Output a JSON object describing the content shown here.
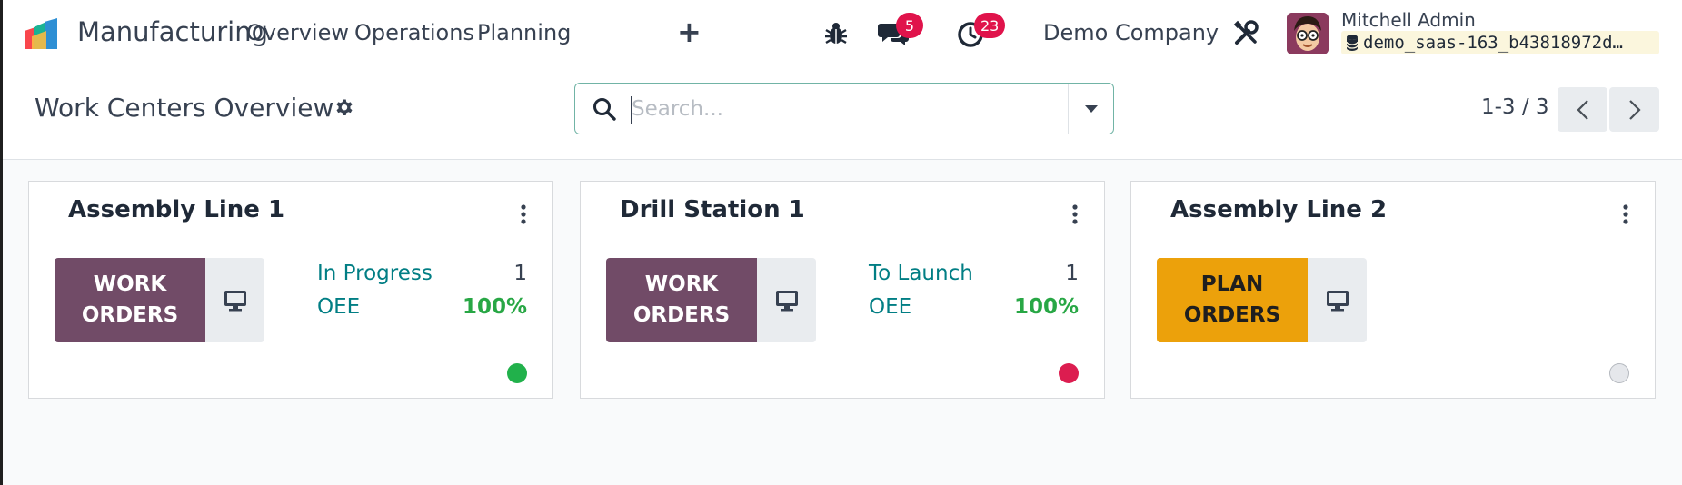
{
  "navbar": {
    "app_name": "Manufacturing",
    "menus": [
      "Overview",
      "Operations",
      "Planning"
    ],
    "add_icon": "plus-icon",
    "messages_badge": "5",
    "activities_badge": "23",
    "company": "Demo Company",
    "user": {
      "name": "Mitchell Admin",
      "database": "demo_saas-163_b43818972d…"
    }
  },
  "control_panel": {
    "title": "Work Centers Overview",
    "search_placeholder": "Search...",
    "pager_value": "1-3 / 3"
  },
  "cards": [
    {
      "title": "Assembly Line 1",
      "button_line1": "WORK",
      "button_line2": "ORDERS",
      "button_color": "#714b67",
      "status_label": "In Progress",
      "status_count": "1",
      "oee_label": "OEE",
      "oee_value": "100%",
      "dot_color": "#21b14b"
    },
    {
      "title": "Drill Station 1",
      "button_line1": "WORK",
      "button_line2": "ORDERS",
      "button_color": "#714b67",
      "status_label": "To Launch",
      "status_count": "1",
      "oee_label": "OEE",
      "oee_value": "100%",
      "dot_color": "#dc1d50"
    },
    {
      "title": "Assembly Line 2",
      "button_line1": "PLAN",
      "button_line2": "ORDERS",
      "button_color": "#eca10b",
      "dot_color": "#e5e7eb"
    }
  ],
  "colors": {
    "brand": "#714b67",
    "accent_teal": "#017e84",
    "badge_red": "#e0134b",
    "success_green": "#28a745"
  }
}
